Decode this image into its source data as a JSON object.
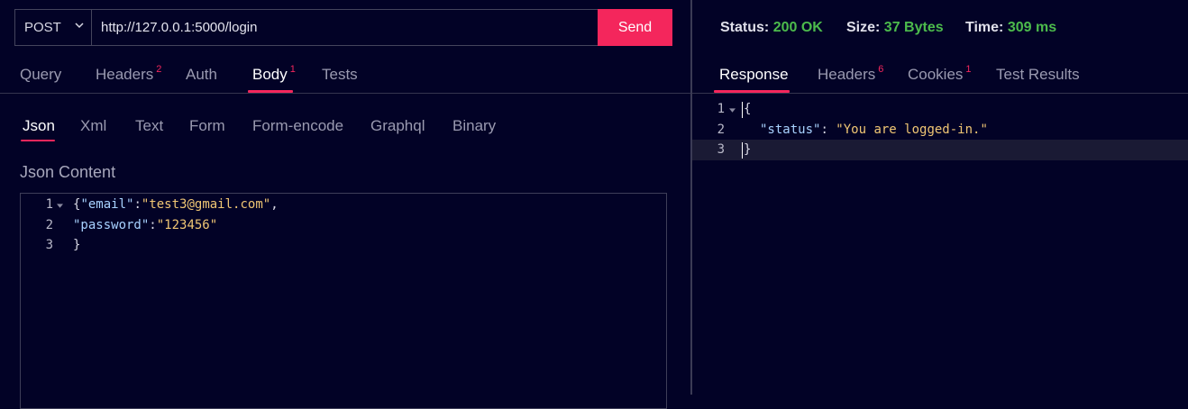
{
  "request": {
    "method": "POST",
    "url": "http://127.0.0.1:5000/login",
    "send_label": "Send"
  },
  "request_tabs": [
    {
      "label": "Query",
      "badge": ""
    },
    {
      "label": "Headers",
      "badge": "2"
    },
    {
      "label": "Auth",
      "badge": ""
    },
    {
      "label": "Body",
      "badge": "1"
    },
    {
      "label": "Tests",
      "badge": ""
    }
  ],
  "body_tabs": [
    "Json",
    "Xml",
    "Text",
    "Form",
    "Form-encode",
    "Graphql",
    "Binary"
  ],
  "json_content_label": "Json Content",
  "request_body": {
    "line_numbers": [
      "1",
      "2",
      "3"
    ],
    "lines": [
      {
        "brace": "{",
        "key": "\"email\"",
        "colon": ":",
        "value": "\"test3@gmail.com\"",
        "end": ","
      },
      {
        "key": "\"password\"",
        "colon": ":",
        "value": "\"123456\""
      },
      {
        "brace": "}"
      }
    ]
  },
  "response_stats": {
    "status_label": "Status:",
    "status_value": "200 OK",
    "size_label": "Size:",
    "size_value": "37 Bytes",
    "time_label": "Time:",
    "time_value": "309 ms"
  },
  "response_tabs": [
    {
      "label": "Response",
      "badge": ""
    },
    {
      "label": "Headers",
      "badge": "6"
    },
    {
      "label": "Cookies",
      "badge": "1"
    },
    {
      "label": "Test Results",
      "badge": ""
    }
  ],
  "response_body": {
    "line_numbers": [
      "1",
      "2",
      "3"
    ],
    "lines": [
      {
        "brace": "{"
      },
      {
        "key": "\"status\"",
        "colon": ": ",
        "value": "\"You are logged-in.\""
      },
      {
        "brace": "}"
      }
    ]
  },
  "colors": {
    "background": "#020226",
    "accent": "#f4265c",
    "success": "#4cbb4c",
    "json_key": "#a8d2ff",
    "json_string": "#f0c674"
  }
}
